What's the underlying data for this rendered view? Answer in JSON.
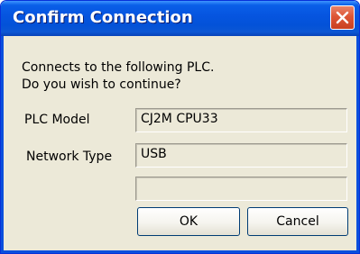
{
  "window": {
    "title": "Confirm Connection",
    "close_icon": "close-x-icon"
  },
  "message": {
    "line1": "Connects to the following PLC.",
    "line2": "Do you wish to continue?"
  },
  "fields": {
    "plc_model": {
      "label": "PLC Model",
      "value": "CJ2M CPU33"
    },
    "network_type": {
      "label": "Network Type",
      "value": "USB"
    },
    "extra": {
      "value": ""
    }
  },
  "buttons": {
    "ok_label": "OK",
    "cancel_label": "Cancel"
  },
  "colors": {
    "titlebar": "#0655e0",
    "frame": "#0a4fdd",
    "dialog_bg": "#ece9d8",
    "close_button": "#dd5535"
  }
}
